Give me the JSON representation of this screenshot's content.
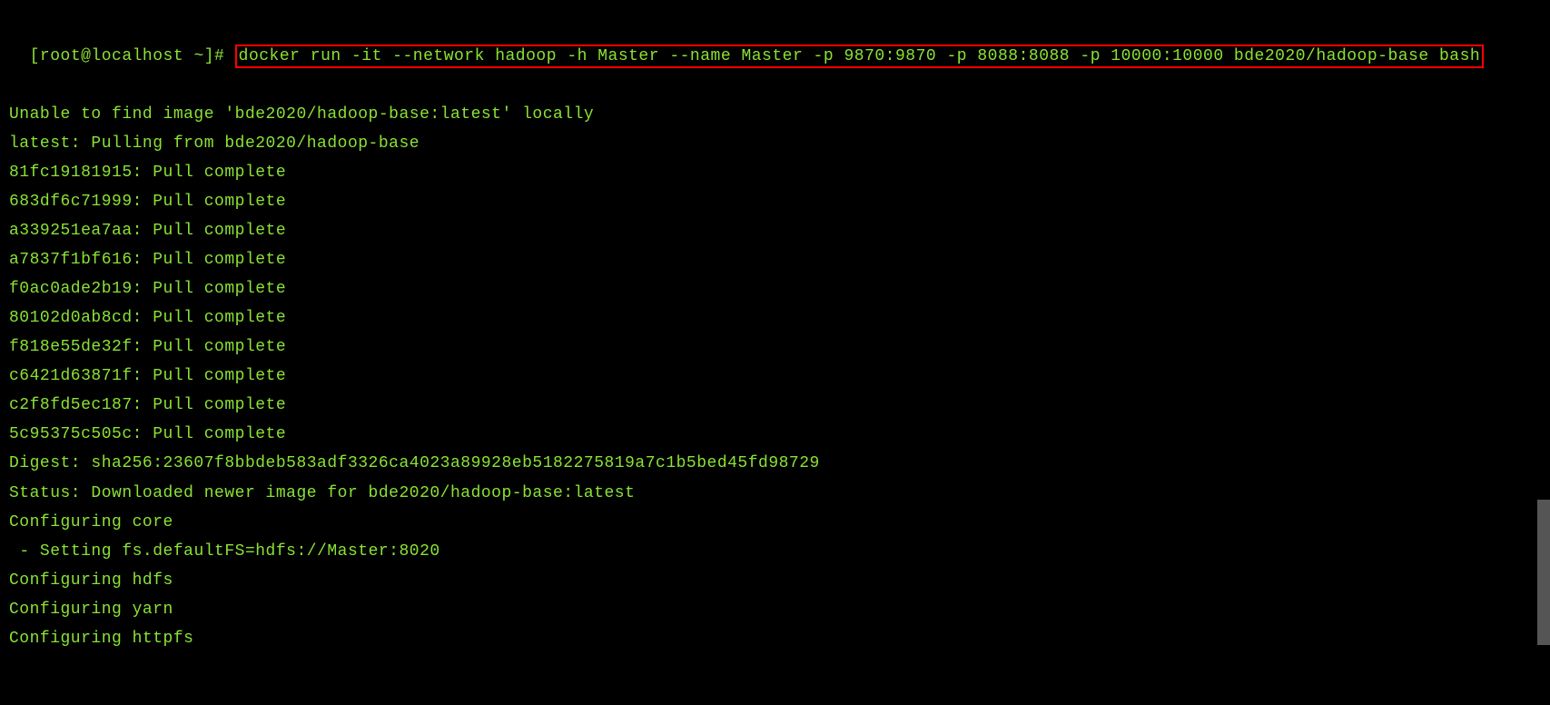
{
  "prompt": "[root@localhost ~]# ",
  "command": "docker run -it --network hadoop -h Master --name Master -p 9870:9870 -p 8088:8088 -p 10000:10000 bde2020/hadoop-base bash",
  "output": [
    "Unable to find image 'bde2020/hadoop-base:latest' locally",
    "latest: Pulling from bde2020/hadoop-base",
    "81fc19181915: Pull complete",
    "683df6c71999: Pull complete",
    "a339251ea7aa: Pull complete",
    "a7837f1bf616: Pull complete",
    "f0ac0ade2b19: Pull complete",
    "80102d0ab8cd: Pull complete",
    "f818e55de32f: Pull complete",
    "c6421d63871f: Pull complete",
    "c2f8fd5ec187: Pull complete",
    "5c95375c505c: Pull complete",
    "Digest: sha256:23607f8bbdeb583adf3326ca4023a89928eb5182275819a7c1b5bed45fd98729",
    "Status: Downloaded newer image for bde2020/hadoop-base:latest",
    "Configuring core",
    " - Setting fs.defaultFS=hdfs://Master:8020",
    "Configuring hdfs",
    "Configuring yarn",
    "Configuring httpfs"
  ]
}
